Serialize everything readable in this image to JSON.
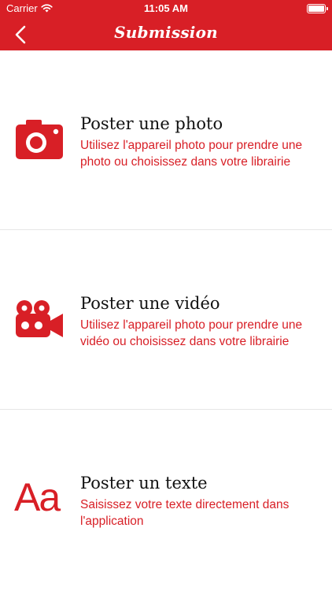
{
  "status_bar": {
    "carrier": "Carrier",
    "time": "11:05 AM"
  },
  "nav": {
    "title": "Submission",
    "back_icon": "chevron-left-icon"
  },
  "theme": {
    "accent": "#d81f26",
    "text": "#111111",
    "divider": "#e6e6e6"
  },
  "items": [
    {
      "icon": "camera-icon",
      "title": "Poster une photo",
      "description": "Utilisez l'appareil photo pour prendre une photo ou choisissez dans votre librairie"
    },
    {
      "icon": "video-camera-icon",
      "title": "Poster une vidéo",
      "description": "Utilisez l'appareil photo pour prendre une vidéo ou choisissez dans votre librairie"
    },
    {
      "icon": "text-icon",
      "icon_text": "Aa",
      "title": "Poster un texte",
      "description": "Saisissez votre texte directement dans l'application"
    }
  ]
}
